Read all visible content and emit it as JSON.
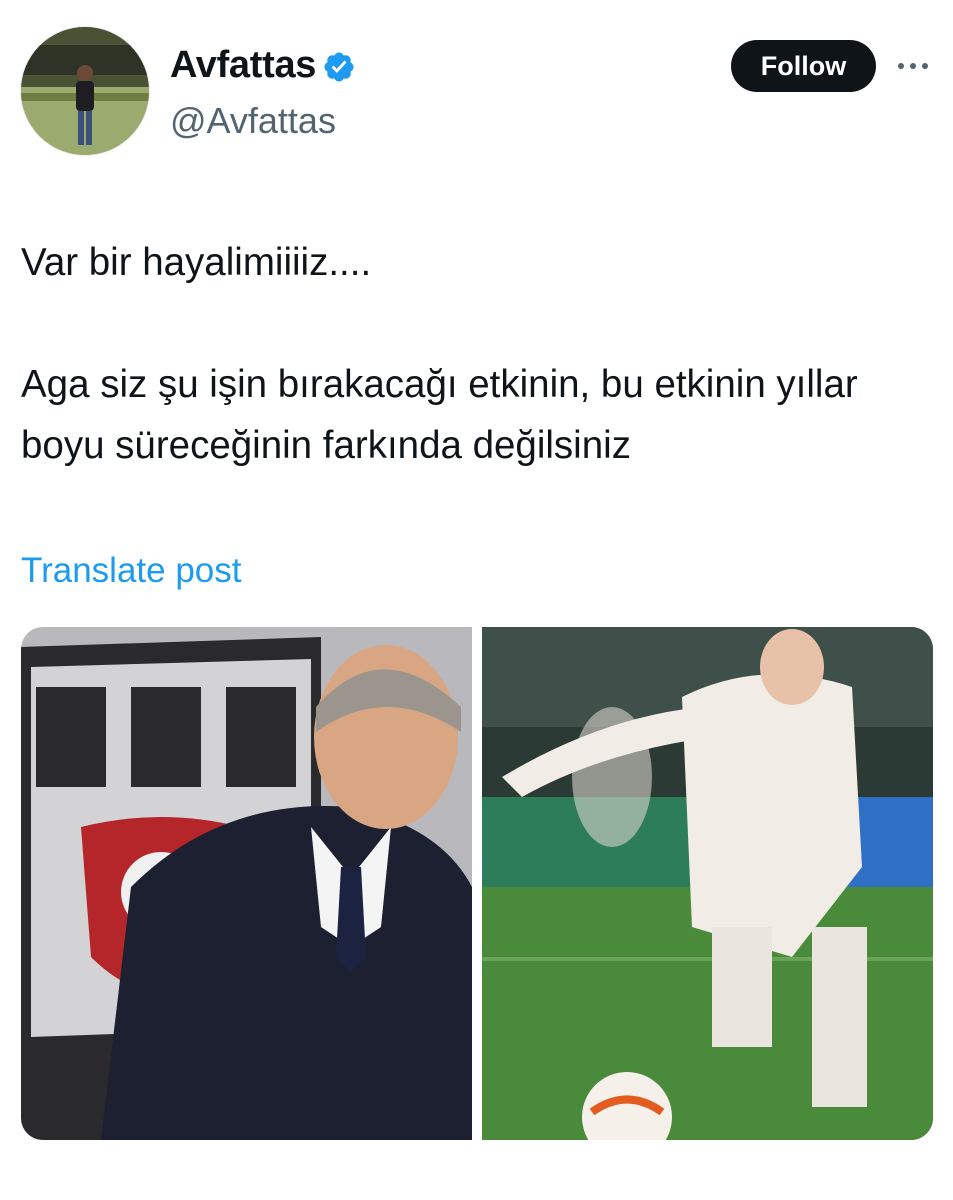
{
  "author": {
    "display_name": "Avfattas",
    "handle": "@Avfattas",
    "verified_badge_icon": "verified-badge-icon",
    "avatar_icon": "profile-avatar"
  },
  "actions": {
    "follow_label": "Follow",
    "more_icon": "more-options-icon"
  },
  "tweet": {
    "lines": [
      "Var bir hayalimiiiiz....",
      "Aga siz şu işin bırakacağı etkinin, bu etkinin yıllar boyu süreceğinin farkında değilsiniz"
    ],
    "translate_label": "Translate post"
  },
  "media": {
    "photos": [
      {
        "name": "media-photo-left"
      },
      {
        "name": "media-photo-right"
      }
    ]
  },
  "colors": {
    "text": "#0f1419",
    "secondary": "#536471",
    "accent": "#1d9bf0",
    "follow_bg": "#0f1419"
  }
}
